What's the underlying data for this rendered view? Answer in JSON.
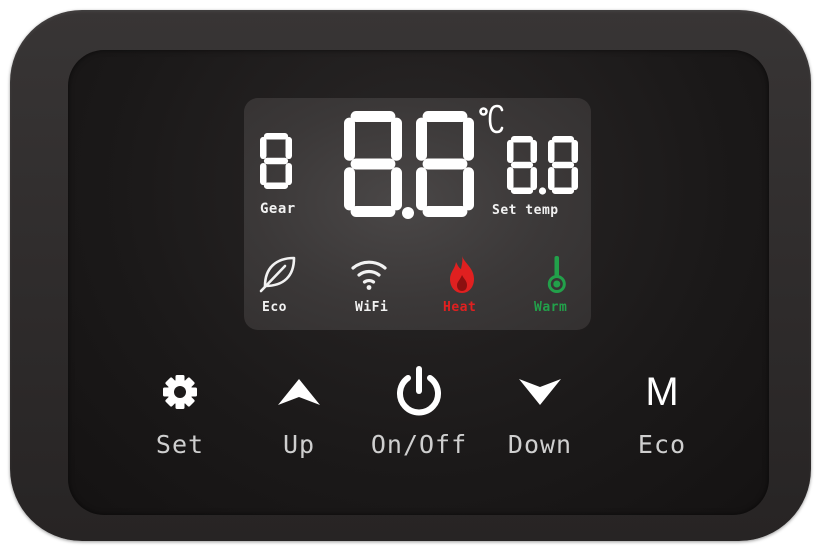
{
  "display": {
    "gear_value": "8",
    "gear_label": "Gear",
    "temp_value": "88",
    "temp_unit": "°C",
    "set_temp_value": "8.8",
    "set_temp_label": "Set temp"
  },
  "indicators": [
    {
      "label": "Eco",
      "icon": "leaf-icon",
      "color": "#f2f2f2"
    },
    {
      "label": "WiFi",
      "icon": "wifi-icon",
      "color": "#f2f2f2"
    },
    {
      "label": "Heat",
      "icon": "flame-icon",
      "color": "#e02020"
    },
    {
      "label": "Warm",
      "icon": "thermometer-icon",
      "color": "#22a04a"
    }
  ],
  "buttons": [
    {
      "label": "Set",
      "icon": "gear-icon"
    },
    {
      "label": "Up",
      "icon": "arrow-up-icon"
    },
    {
      "label": "On/Off",
      "icon": "power-icon"
    },
    {
      "label": "Down",
      "icon": "arrow-down-icon"
    },
    {
      "label": "Eco",
      "icon": "m-mode-icon",
      "glyph": "M"
    }
  ],
  "colors": {
    "segment": "#ffffff",
    "heat": "#e02020",
    "warm": "#22a04a",
    "button_label": "#cfcfcf"
  }
}
